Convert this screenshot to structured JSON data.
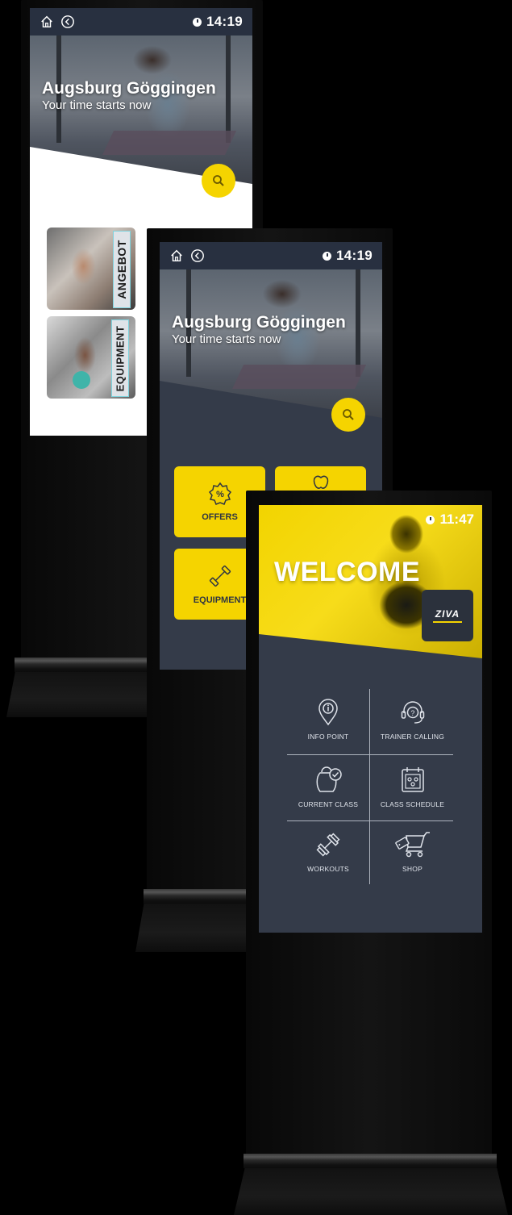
{
  "back_panel": {
    "time": "14:19",
    "location_title": "Augsburg Göggingen",
    "tagline": "Your time starts now",
    "cards": [
      {
        "label": "ANGEBOT"
      },
      {
        "label": "EQUIPMENT"
      }
    ]
  },
  "middle_panel": {
    "time": "14:19",
    "location_title": "Augsburg Göggingen",
    "tagline": "Your time starts now",
    "tiles": [
      {
        "label": "OFFERS"
      },
      {
        "label": "EQUIPMENT"
      }
    ]
  },
  "front_panel": {
    "time": "11:47",
    "welcome": "WELCOME",
    "logo_text": "ZIVA",
    "menu": [
      {
        "label": "INFO POINT",
        "icon": "map-pin-info-icon"
      },
      {
        "label": "TRAINER CALLING",
        "icon": "headset-question-icon"
      },
      {
        "label": "CURRENT CLASS",
        "icon": "kettlebell-check-icon"
      },
      {
        "label": "CLASS SCHEDULE",
        "icon": "calendar-icon"
      },
      {
        "label": "WORKOUTS",
        "icon": "dumbbell-icon"
      },
      {
        "label": "SHOP",
        "icon": "cart-icon"
      }
    ]
  },
  "colors": {
    "accent": "#f5d400",
    "dark": "#283040",
    "panel": "#343b49"
  }
}
